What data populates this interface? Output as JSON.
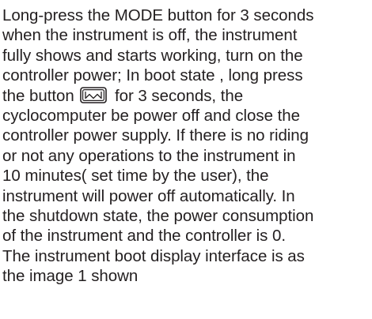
{
  "paragraph": {
    "lines": [
      "Long-press the MODE button for 3 seconds",
      "when the instrument is off, the instrument",
      "fully shows and starts working, turn on the",
      "controller power; In boot state , long press",
      "the button",
      "for 3 seconds, the",
      "cyclocomputer be power off and close the",
      "controller power supply. If there is no riding",
      "or not any operations to the instrument in",
      "10 minutes( set time by the user), the",
      "instrument will power off automatically. In",
      "the shutdown state, the power consumption",
      "of the instrument and the controller is 0.",
      "The instrument boot display interface is as",
      "the image 1 shown"
    ]
  },
  "icons": {
    "mode_button": "mode-button-icon"
  },
  "colors": {
    "text": "#231f20",
    "background": "#ffffff"
  }
}
